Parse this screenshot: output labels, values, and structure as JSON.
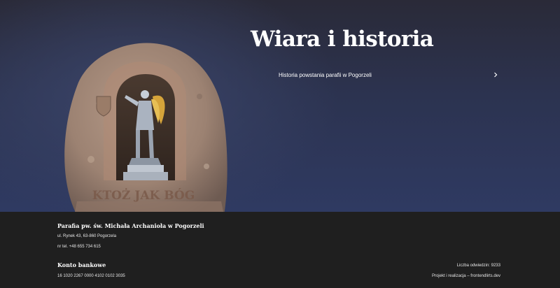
{
  "hero": {
    "title": "Wiara i historia",
    "link_label": "Historia powstania parafii w Pogorzeli",
    "image_label": "KTOŻ JAK BÓG",
    "icons": {
      "link_arrow": "chevron-right-icon"
    }
  },
  "footer": {
    "parish_name": "Parafia pw. św. Michała Archanioła w Pogorzeli",
    "address": "ul. Rynek 43, 63-860 Pogorzela",
    "phone": "nr tel. +48 655 734 615",
    "bank_heading": "Konto bankowe",
    "bank_account": "16 1020 2267 0000 4102 0102 3035",
    "visits": "Liczba odwiedzin: 9233",
    "credit": "Projekt i realizacja – frontendlirts.dev"
  },
  "colors": {
    "hero_bg": "#2c3350",
    "footer_bg": "#1f1f1f",
    "text": "#ffffff"
  }
}
